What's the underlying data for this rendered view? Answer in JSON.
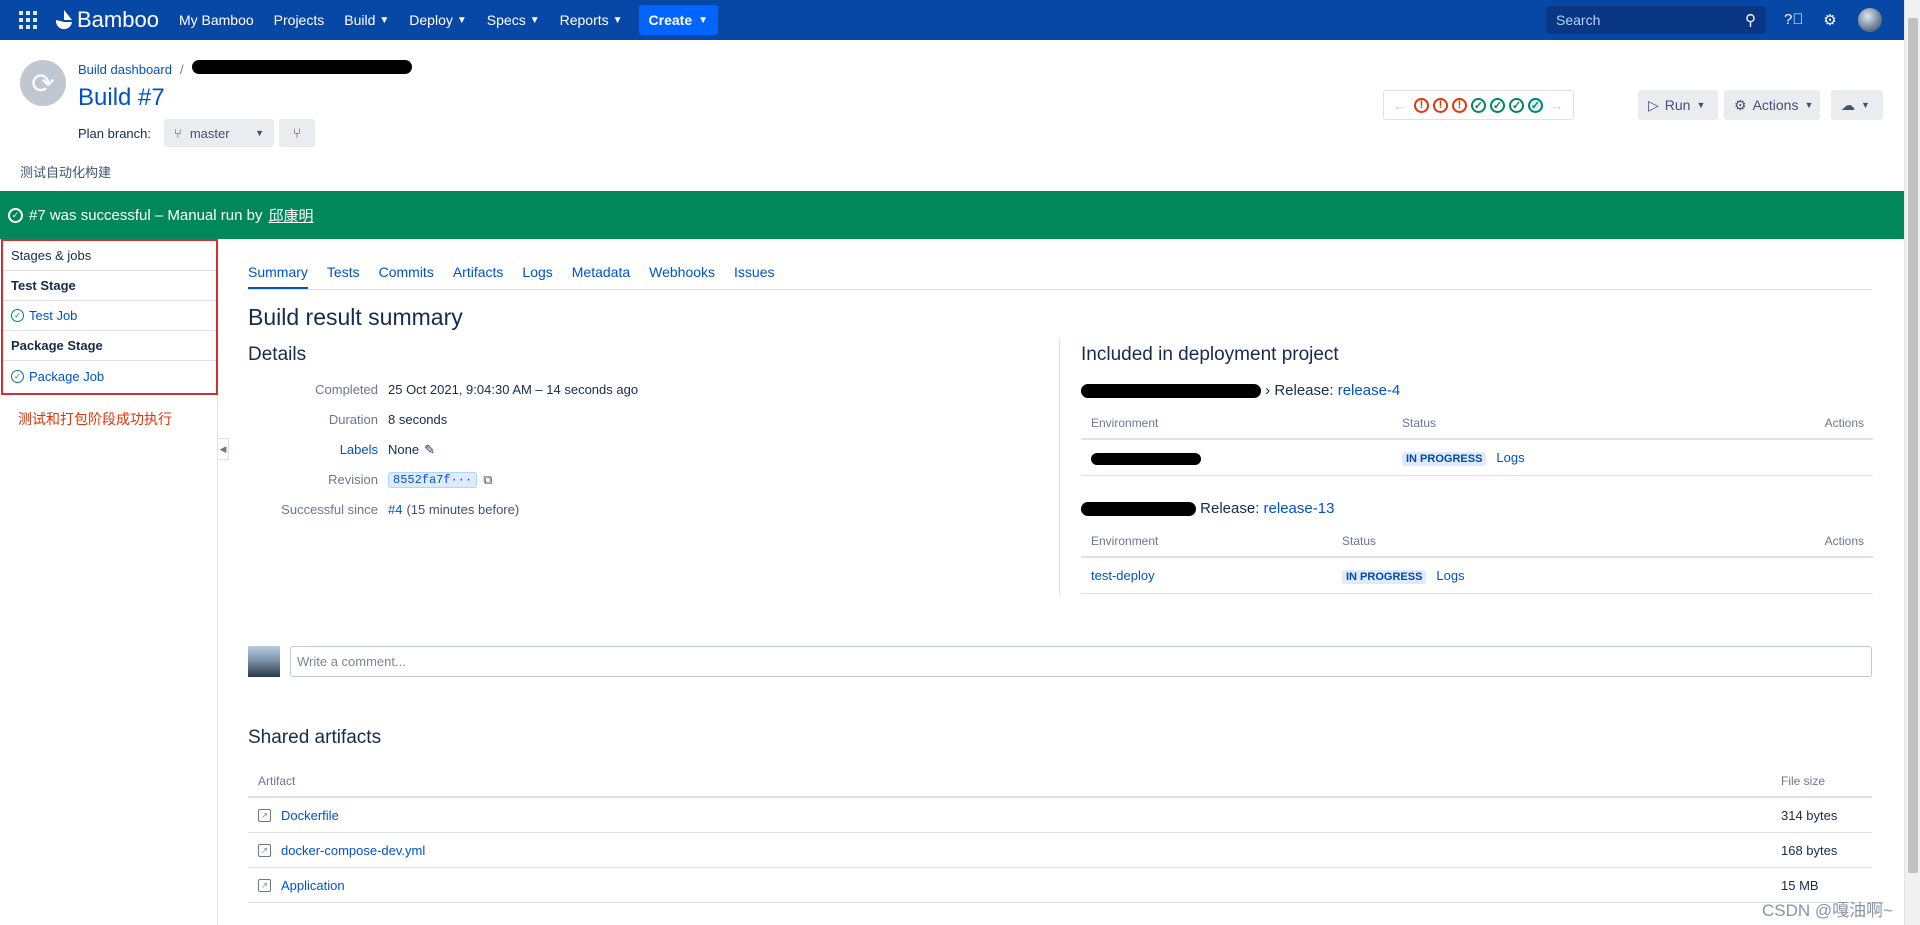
{
  "nav": {
    "brand": "Bamboo",
    "items": [
      {
        "label": "My Bamboo",
        "dropdown": false
      },
      {
        "label": "Projects",
        "dropdown": false
      },
      {
        "label": "Build",
        "dropdown": true
      },
      {
        "label": "Deploy",
        "dropdown": true
      },
      {
        "label": "Specs",
        "dropdown": true
      },
      {
        "label": "Reports",
        "dropdown": true
      }
    ],
    "create_label": "Create",
    "search_placeholder": "Search",
    "colors": {
      "nav_bg": "#0747a6",
      "create_bg": "#0065ff"
    }
  },
  "header": {
    "breadcrumb_root": "Build dashboard",
    "title": "Build #7",
    "plan_branch_label": "Plan branch:",
    "branch_name": "master",
    "description": "测试自动化构建"
  },
  "history": {
    "statuses": [
      "failed",
      "failed",
      "failed",
      "successful",
      "successful",
      "successful",
      "current-successful"
    ]
  },
  "toolbar": {
    "run_label": "Run",
    "actions_label": "Actions"
  },
  "banner": {
    "text": "#7 was successful – Manual run by ",
    "user": "邱康明",
    "color": "#00875a"
  },
  "sidebar": {
    "header": "Stages & jobs",
    "stages": [
      {
        "name": "Test Stage",
        "job": "Test Job"
      },
      {
        "name": "Package Stage",
        "job": "Package Job"
      }
    ],
    "annotation": "测试和打包阶段成功执行"
  },
  "tabs": [
    "Summary",
    "Tests",
    "Commits",
    "Artifacts",
    "Logs",
    "Metadata",
    "Webhooks",
    "Issues"
  ],
  "summary": {
    "heading": "Build result summary",
    "details_heading": "Details",
    "completed_label": "Completed",
    "completed_value": "25 Oct 2021, 9:04:30 AM – 14 seconds ago",
    "duration_label": "Duration",
    "duration_value": "8 seconds",
    "labels_label": "Labels",
    "labels_value": "None",
    "revision_label": "Revision",
    "revision_value": "8552fa7f···",
    "since_label": "Successful since",
    "since_link": "#4",
    "since_rest": "(15 minutes before)"
  },
  "deployment": {
    "heading": "Included in deployment project",
    "projects": [
      {
        "release_prefix": "› Release:",
        "release": "release-4",
        "env_header": "Environment",
        "status_header": "Status",
        "actions_header": "Actions",
        "env": "",
        "status": "IN PROGRESS",
        "logs": "Logs"
      },
      {
        "release_prefix": "Release:",
        "release": "release-13",
        "env_header": "Environment",
        "status_header": "Status",
        "actions_header": "Actions",
        "env": "test-deploy",
        "status": "IN PROGRESS",
        "logs": "Logs"
      }
    ]
  },
  "comment": {
    "placeholder": "Write a comment..."
  },
  "artifacts": {
    "heading": "Shared artifacts",
    "col_artifact": "Artifact",
    "col_size": "File size",
    "rows": [
      {
        "name": "Dockerfile",
        "size": "314 bytes"
      },
      {
        "name": "docker-compose-dev.yml",
        "size": "168 bytes"
      },
      {
        "name": "Application",
        "size": "15 MB"
      }
    ]
  },
  "watermark": "CSDN @嘎油啊~"
}
